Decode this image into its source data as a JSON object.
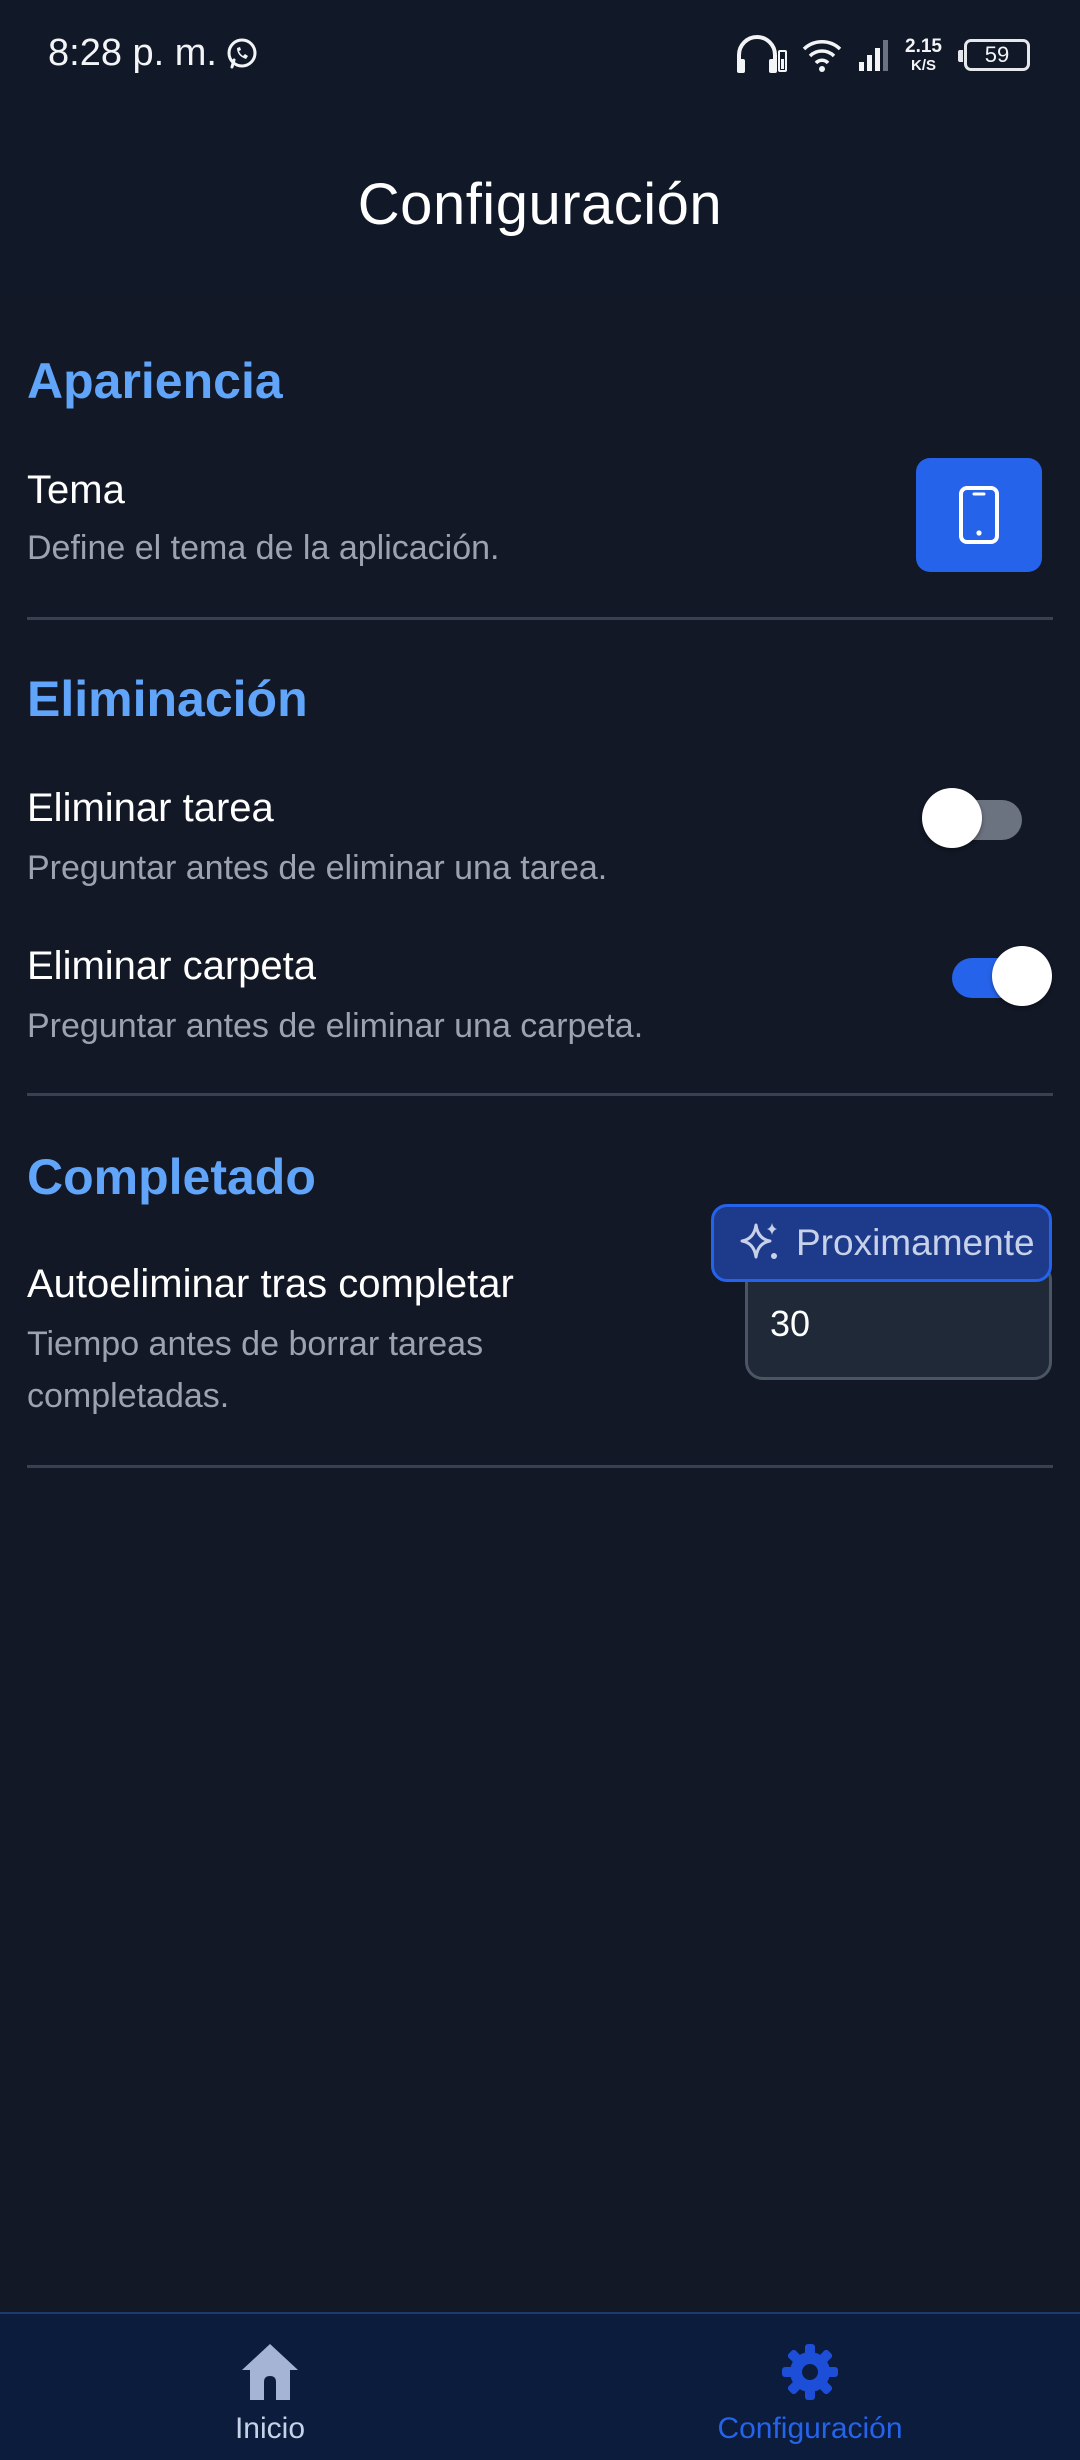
{
  "status_bar": {
    "time": "8:28 p. m.",
    "net_speed_value": "2.15",
    "net_speed_unit": "K/S",
    "battery": "59"
  },
  "header": {
    "title": "Configuración"
  },
  "sections": {
    "appearance": {
      "title": "Apariencia",
      "theme_title": "Tema",
      "theme_desc": "Define el tema de la aplicación.",
      "theme_icon": "smartphone-icon"
    },
    "deletion": {
      "title": "Eliminación",
      "task_title": "Eliminar tarea",
      "task_desc": "Preguntar antes de eliminar una tarea.",
      "task_toggle_on": false,
      "folder_title": "Eliminar carpeta",
      "folder_desc": "Preguntar antes de eliminar una carpeta.",
      "folder_toggle_on": true
    },
    "completed": {
      "title": "Completado",
      "auto_title": "Autoeliminar tras completar",
      "auto_desc_line1": "Tiempo antes de borrar tareas",
      "auto_desc_line2": "completadas.",
      "auto_value": "30",
      "soon_badge": "Proximamente"
    }
  },
  "bottom_nav": {
    "home_label": "Inicio",
    "settings_label": "Configuración",
    "active": "settings"
  },
  "colors": {
    "background": "#121826",
    "accent": "#2563eb",
    "section_title": "#60a5fa",
    "muted_text": "#9ca3af"
  }
}
